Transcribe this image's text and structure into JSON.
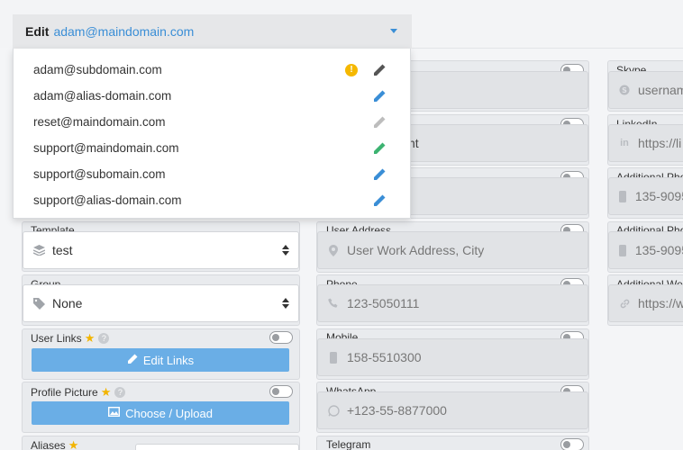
{
  "edit": {
    "label": "Edit",
    "value": "adam@maindomain.com"
  },
  "dropdown": [
    {
      "email": "adam@subdomain.com",
      "pen_color": "#555555",
      "warning": "!"
    },
    {
      "email": "adam@alias-domain.com",
      "pen_color": "#3a8ed6"
    },
    {
      "email": "reset@maindomain.com",
      "pen_color": "#bdbdbd"
    },
    {
      "email": "support@maindomain.com",
      "pen_color": "#3cb371"
    },
    {
      "email": "support@subomain.com",
      "pen_color": "#3a8ed6"
    },
    {
      "email": "support@alias-domain.com",
      "pen_color": "#3a8ed6"
    }
  ],
  "col1": {
    "template": {
      "label": "Template",
      "value": "test",
      "icon": "layers-icon"
    },
    "group": {
      "label": "Group",
      "value": "None",
      "icon": "tag-icon"
    },
    "user_links": {
      "label": "User Links",
      "button": "Edit Links",
      "icon": "pencil-icon"
    },
    "profile_picture": {
      "label": "Profile Picture",
      "button": "Choose / Upload",
      "icon": "image-icon"
    },
    "aliases": {
      "label": "Aliases"
    }
  },
  "col2": {
    "row1": {
      "value": ""
    },
    "row2": {
      "value": "nt"
    },
    "row3": {
      "value": ""
    },
    "user_address": {
      "label": "User Address",
      "placeholder": "User Work Address, City",
      "icon": "map-marker-icon"
    },
    "phone": {
      "label": "Phone",
      "placeholder": "123-5050111",
      "icon": "phone-icon"
    },
    "mobile": {
      "label": "Mobile",
      "placeholder": "158-5510300",
      "icon": "mobile-icon"
    },
    "whatsapp": {
      "label": "WhatsApp",
      "placeholder": "+123-55-8877000",
      "icon": "whatsapp-icon"
    },
    "telegram": {
      "label": "Telegram"
    }
  },
  "col3": {
    "skype": {
      "label": "Skype",
      "placeholder": "usernam",
      "icon": "skype-icon"
    },
    "linkedin": {
      "label": "LinkedIn",
      "placeholder": "https://li",
      "icon": "linkedin-icon"
    },
    "addl_phone1": {
      "label": "Additional Pho",
      "placeholder": "135-9095",
      "icon": "mobile-icon"
    },
    "addl_phone2": {
      "label": "Additional Pho",
      "placeholder": "135-9095",
      "icon": "mobile-icon"
    },
    "addl_web": {
      "label": "Additional We",
      "placeholder": "https://w",
      "icon": "link-icon"
    }
  }
}
